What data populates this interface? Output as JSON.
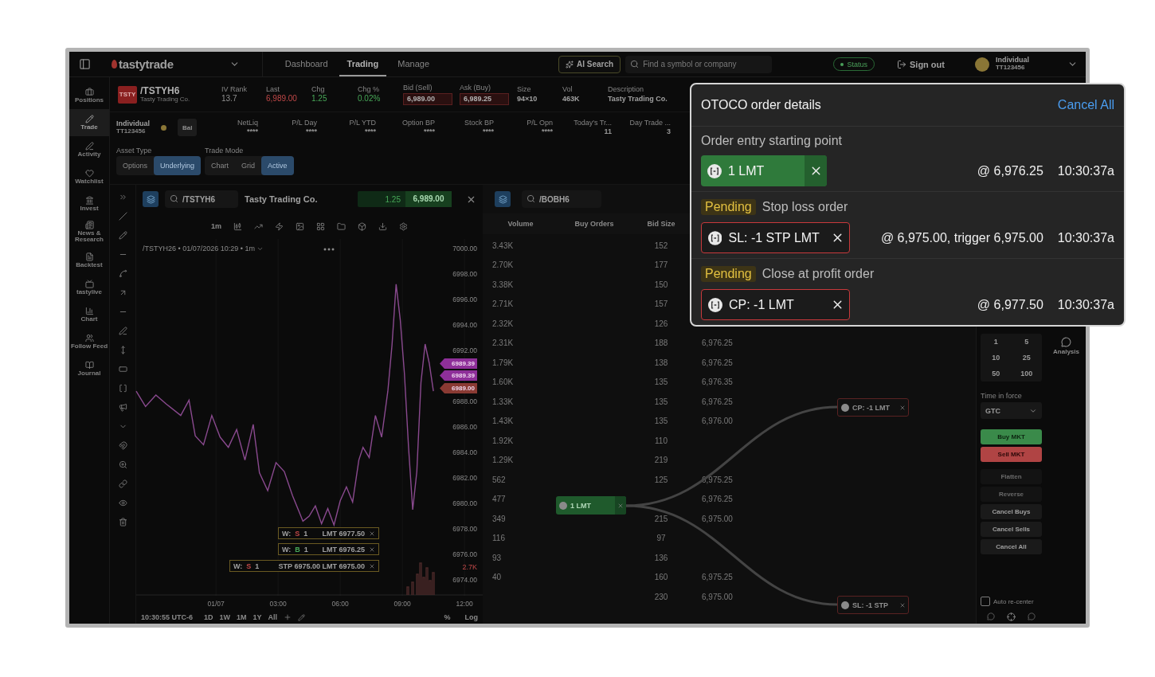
{
  "top_bar": {
    "logo": "tastytrade",
    "nav": [
      {
        "label": "Dashboard",
        "selected": false
      },
      {
        "label": "Trading",
        "selected": true
      },
      {
        "label": "Manage",
        "selected": false
      }
    ],
    "ai_button": "AI Search",
    "search": {
      "placeholder": "Find a symbol or company"
    },
    "status": "Status",
    "sign_out": "Sign out",
    "account": {
      "name": "Individual",
      "number": "TT123456"
    }
  },
  "sidebar": [
    {
      "label": "Positions",
      "selected": false
    },
    {
      "label": "Trade",
      "selected": true
    },
    {
      "label": "Activity",
      "selected": false
    },
    {
      "label": "Watchlist",
      "selected": false
    },
    {
      "label": "Invest",
      "selected": false
    },
    {
      "label": "News & Research",
      "selected": false
    },
    {
      "label": "Backtest",
      "selected": false
    },
    {
      "label": "tastylive",
      "selected": false
    },
    {
      "label": "Chart",
      "selected": false
    },
    {
      "label": "Follow Feed",
      "selected": false
    },
    {
      "label": "Journal",
      "selected": false
    }
  ],
  "quote": {
    "badge": "TSTY",
    "symbol": "/TSTYH6",
    "company": "Tasty Trading Co.",
    "fields": [
      {
        "label": "IV Rank",
        "value": "13.7",
        "kind": "plain"
      },
      {
        "label": "Last",
        "value": "6,989.00",
        "kind": "negative"
      },
      {
        "label": "Chg",
        "value": "1.25",
        "kind": "positive"
      },
      {
        "label": "Chg %",
        "value": "0.02%",
        "kind": "positive"
      },
      {
        "label": "Bid (Sell)",
        "value": "6,989.00",
        "kind": "boxed"
      },
      {
        "label": "Ask (Buy)",
        "value": "6,989.25",
        "kind": "boxed"
      },
      {
        "label": "Size",
        "value": "94×10",
        "kind": "bold"
      },
      {
        "label": "Vol",
        "value": "463K",
        "kind": "bold"
      },
      {
        "label": "Description",
        "value": "Tasty Trading Co.",
        "kind": "bold"
      }
    ]
  },
  "account_bar": {
    "name": "Individual",
    "number": "TT123456",
    "balance_button": "Bal",
    "metrics": [
      {
        "label": "NetLiq",
        "value": "****"
      },
      {
        "label": "P/L Day",
        "value": "****"
      },
      {
        "label": "P/L YTD",
        "value": "****"
      },
      {
        "label": "Option BP",
        "value": "****"
      },
      {
        "label": "Stock BP",
        "value": "****"
      },
      {
        "label": "P/L Opn",
        "value": "****"
      },
      {
        "label": "Today's Tr...",
        "value": "11"
      },
      {
        "label": "Day Trade ...",
        "value": "3"
      }
    ]
  },
  "modes": [
    {
      "label": "Asset Type",
      "options": [
        {
          "label": "Options",
          "selected": false
        },
        {
          "label": "Underlying",
          "selected": true
        }
      ]
    },
    {
      "label": "Trade Mode",
      "options": [
        {
          "label": "Chart",
          "selected": false
        },
        {
          "label": "Grid",
          "selected": false
        },
        {
          "label": "Active",
          "selected": true
        }
      ]
    }
  ],
  "chart_panel": {
    "symbol": "/TSTYH6",
    "company": "Tasty Trading Co.",
    "change": "1.25",
    "price": "6,989.00",
    "interval": "1m",
    "legend": "/TSTYH26 • 01/07/2026 10:29 • 1m",
    "price_tags": [
      {
        "label": "6989.39",
        "color": "#8e2f99"
      },
      {
        "label": "6989.39",
        "color": "#8e2f99"
      },
      {
        "label": "6989.00",
        "color": "#8a3a33"
      }
    ],
    "order_lines": [
      {
        "prefix": "W:",
        "kind": "sell",
        "side_label": "S",
        "quantity": "1",
        "text": "LMT 6977.50"
      },
      {
        "prefix": "W:",
        "kind": "buy",
        "side_label": "B",
        "quantity": "1",
        "text": "LMT 6976.25"
      },
      {
        "prefix": "W:",
        "kind": "sell",
        "side_label": "S",
        "quantity": "1",
        "text": "STP 6975.00 LMT 6975.00"
      }
    ],
    "volume_label": "2.7K",
    "time": "10:30:55 UTC-6",
    "ranges": [
      "1D",
      "1W",
      "1M",
      "1Y",
      "All"
    ],
    "scale_options": [
      "%",
      "Log"
    ],
    "chart_data": {
      "type": "line",
      "grid": true,
      "xlim": [
        -3.85,
        12.88
      ],
      "ylim": [
        6970.5,
        7005
      ],
      "x": [
        -3.85,
        -3.4,
        -2.9,
        -2.4,
        -1.7,
        -1.3,
        -1,
        -0.6,
        -0.2,
        0.2,
        0.6,
        1,
        1.4,
        1.8,
        2.1,
        2.5,
        2.9,
        3.3,
        3.7,
        4,
        4.2,
        4.5,
        4.8,
        5.1,
        5.4,
        5.7,
        6,
        6.3,
        6.6,
        6.9,
        7.1,
        7.4,
        7.7,
        8,
        8.3,
        8.5,
        8.7,
        8.9,
        9.1,
        9.3,
        9.5,
        9.7,
        9.9,
        10.1,
        10.3,
        10.5
      ],
      "series": [
        {
          "color": "#8a4a8f",
          "values": [
            6988.8,
            6987.6,
            6988.5,
            6987.8,
            6986.9,
            6988.1,
            6985.3,
            6984.6,
            6986.9,
            6985.2,
            6984.4,
            6985.8,
            6983.4,
            6986.2,
            6982.4,
            6981,
            6983.2,
            6982.5,
            6980.6,
            6979.4,
            6978.6,
            6979,
            6979.8,
            6978.4,
            6979.6,
            6978.3,
            6980.2,
            6981.3,
            6980.1,
            6983.4,
            6984.4,
            6983.6,
            6986.9,
            6985.2,
            6988.8,
            6992.4,
            6997.2,
            6994.4,
            6990.2,
            6984.4,
            6979.5,
            6982.5,
            6989.5,
            6992.5,
            6991,
            6988.8
          ]
        }
      ],
      "xticks": [
        {
          "value": 0,
          "label": "01/07"
        },
        {
          "value": 3,
          "label": "03:00"
        },
        {
          "value": 6,
          "label": "06:00"
        },
        {
          "value": 9,
          "label": "09:00"
        },
        {
          "value": 12,
          "label": "12:00"
        }
      ],
      "yticks": [
        {
          "value": 7000,
          "label": "7000.00"
        },
        {
          "value": 6998,
          "label": "6998.00"
        },
        {
          "value": 6996,
          "label": "6996.00"
        },
        {
          "value": 6994,
          "label": "6994.00"
        },
        {
          "value": 6992,
          "label": "6992.00"
        },
        {
          "value": 6988,
          "label": "6988.00"
        },
        {
          "value": 6986,
          "label": "6986.00"
        },
        {
          "value": 6984,
          "label": "6984.00"
        },
        {
          "value": 6982,
          "label": "6982.00"
        },
        {
          "value": 6980,
          "label": "6980.00"
        },
        {
          "value": 6978,
          "label": "6978.00"
        },
        {
          "value": 6976,
          "label": "6976.00"
        },
        {
          "value": 6974,
          "label": "6974.00"
        }
      ]
    }
  },
  "order_book": {
    "symbol": "/BOBH6",
    "columns": [
      "Volume",
      "Buy Orders",
      "Bid Size"
    ],
    "rows": [
      {
        "volume": "3.43K",
        "bid_size": "152"
      },
      {
        "volume": "2.70K",
        "bid_size": "177"
      },
      {
        "volume": "3.38K",
        "bid_size": "150"
      },
      {
        "volume": "2.71K",
        "bid_size": "157"
      },
      {
        "volume": "2.32K",
        "bid_size": "126"
      },
      {
        "volume": "2.31K",
        "bid_size": "188",
        "price": "6,976.25"
      },
      {
        "volume": "1.79K",
        "bid_size": "138",
        "price": "6,976.25"
      },
      {
        "volume": "1.60K",
        "bid_size": "135",
        "price": "6,976.35"
      },
      {
        "volume": "1.33K",
        "bid_size": "135",
        "price": "6,976.25"
      },
      {
        "volume": "1.43K",
        "bid_size": "135",
        "price": "6,976.00"
      },
      {
        "volume": "1.92K",
        "bid_size": "110"
      },
      {
        "volume": "1.29K",
        "bid_size": "219"
      },
      {
        "volume": "562",
        "bid_size": "125",
        "price": "6,975.25"
      },
      {
        "volume": "477",
        "price": "6,976.25"
      },
      {
        "volume": "349",
        "bid_size": "215",
        "price": "6,975.00"
      },
      {
        "volume": "116",
        "bid_size": "97"
      },
      {
        "volume": "93",
        "bid_size": "136"
      },
      {
        "volume": "40",
        "bid_size": "160",
        "price": "6,975.25"
      },
      {
        "bid_size": "230",
        "price": "6,975.00"
      }
    ],
    "nodes": [
      {
        "label": "1 LMT",
        "kind": "buy"
      },
      {
        "label": "CP: -1 LMT",
        "kind": "sell"
      },
      {
        "label": "SL: -1 STP",
        "kind": "sell"
      }
    ]
  },
  "trade_panel": {
    "quantities": [
      "1",
      "5",
      "10",
      "25",
      "50",
      "100"
    ],
    "time_in_force": {
      "label": "Time in force",
      "value": "GTC"
    },
    "buttons": [
      {
        "label": "Buy MKT",
        "kind": "buy"
      },
      {
        "label": "Sell MKT",
        "kind": "sell"
      },
      {
        "label": "Flatten",
        "kind": "disabled"
      },
      {
        "label": "Reverse",
        "kind": "disabled"
      },
      {
        "label": "Cancel Buys",
        "kind": "plain"
      },
      {
        "label": "Cancel Sells",
        "kind": "plain"
      },
      {
        "label": "Cancel All",
        "kind": "plain"
      }
    ],
    "auto_recenter": {
      "label": "Auto re-center",
      "checked": false
    }
  },
  "analysis": {
    "label": "Analysis"
  },
  "order_details": {
    "title": "OTOCO order details",
    "cancel_all": "Cancel All",
    "legs": [
      {
        "heading": "Order entry starting point",
        "pending": false,
        "order": "1 LMT",
        "kind": "buy",
        "price": "@ 6,976.25",
        "time": "10:30:37a"
      },
      {
        "badge": "Pending",
        "heading": "Stop loss order",
        "pending": true,
        "order": "SL: -1 STP LMT",
        "kind": "sell",
        "price": "@ 6,975.00, trigger 6,975.00",
        "time": "10:30:37a"
      },
      {
        "badge": "Pending",
        "heading": "Close at profit order",
        "pending": true,
        "order": "CP: -1 LMT",
        "kind": "sell",
        "price": "@ 6,977.50",
        "time": "10:30:37a"
      }
    ]
  }
}
